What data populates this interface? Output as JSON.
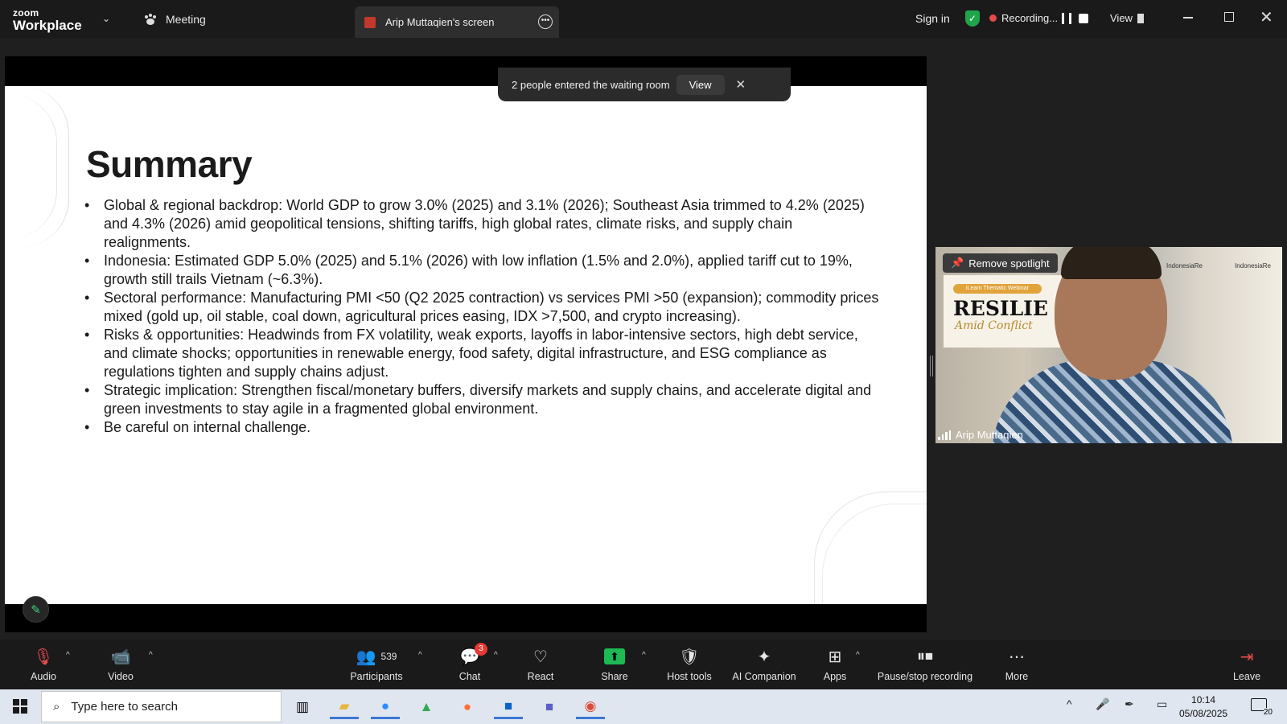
{
  "app": {
    "logo_line1": "zoom",
    "logo_line2": "Workplace",
    "tab_meeting": "Meeting",
    "tab_screen": "Arip Muttaqien's screen",
    "sign_in": "Sign in",
    "recording": "Recording...",
    "view": "View"
  },
  "notification": {
    "text": "2 people entered the waiting room",
    "view_label": "View",
    "close": "✕"
  },
  "slide": {
    "title": "Summary",
    "bullets": [
      "Global & regional backdrop: World GDP to grow 3.0% (2025) and 3.1% (2026); Southeast Asia trimmed to 4.2% (2025) and 4.3% (2026) amid geopolitical tensions, shifting tariffs, high global rates, climate risks, and supply chain realignments.",
      "Indonesia: Estimated GDP 5.0% (2025) and 5.1% (2026) with low inflation (1.5% and 2.0%), applied tariff cut to 19%, growth still trails Vietnam (~6.3%).",
      "Sectoral performance: Manufacturing PMI <50 (Q2 2025 contraction) vs services PMI >50 (expansion); commodity prices mixed (gold up, oil stable, coal down, agricultural prices easing, IDX >7,500, and crypto increasing).",
      "Risks & opportunities: Headwinds from FX volatility, weak exports, layoffs in labor-intensive sectors, high debt service, and climate shocks; opportunities in renewable energy, food safety, digital infrastructure, and ESG compliance as regulations tighten and supply chains adjust.",
      "Strategic implication: Strengthen fiscal/monetary buffers, diversify markets and supply chains, and accelerate digital and green investments to stay agile in a fragmented global environment.",
      "Be careful on internal challenge."
    ]
  },
  "video": {
    "spotlight_btn": "Remove spotlight",
    "name": "Arip Muttaqien",
    "banner_pill": "iLearn Thematic Webinar",
    "banner_word": "RESILIE",
    "banner_sub": "Amid Conflict",
    "logo_left": "IndonesiaRe",
    "logo_right": "IndonesiaRe"
  },
  "toolbar": {
    "audio": "Audio",
    "video": "Video",
    "participants": "Participants",
    "participants_count": "539",
    "chat": "Chat",
    "chat_badge": "3",
    "react": "React",
    "share": "Share",
    "host_tools": "Host tools",
    "ai_companion": "AI Companion",
    "apps": "Apps",
    "pause_stop": "Pause/stop recording",
    "more": "More",
    "leave": "Leave"
  },
  "taskbar": {
    "search_placeholder": "Type here to search",
    "time": "10:14",
    "date": "05/08/2025",
    "notif_count": "20"
  },
  "colors": {
    "accent_green": "#1db954",
    "record_red": "#e64b4b",
    "badge_red": "#e53935"
  }
}
